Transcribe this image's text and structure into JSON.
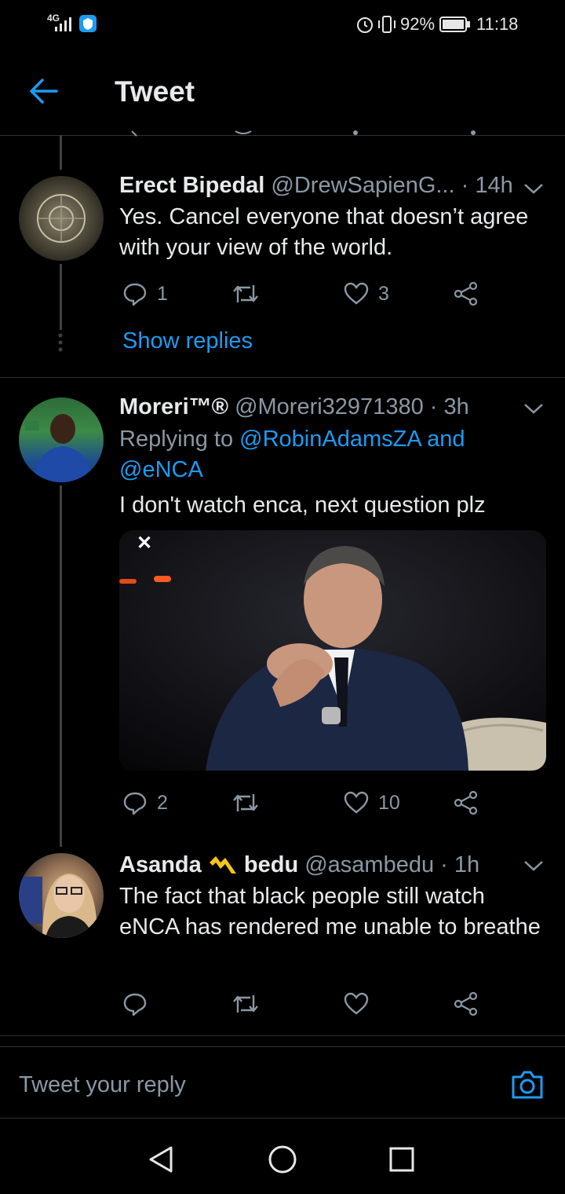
{
  "status_bar": {
    "network": "4G",
    "battery": "92%",
    "time": "11:18"
  },
  "header": {
    "title": "Tweet"
  },
  "tweets": [
    {
      "name": "Erect Bipedal",
      "handle": "@DrewSapienG...",
      "time": "· 14h",
      "text": "Yes. Cancel everyone that doesn’t agree with your view of the world.",
      "replies": "1",
      "retweets": "",
      "likes": "3",
      "show_replies": "Show replies"
    },
    {
      "name": "Moreri™®",
      "handle": "@Moreri32971380",
      "time": "· 3h",
      "replying_prefix": "Replying to",
      "replying_to_1": "@RobinAdamsZA",
      "replying_and": "and",
      "replying_to_2": "@eNCA",
      "text": "I don't watch enca, next question plz",
      "media_close": "✕",
      "replies": "2",
      "retweets": "",
      "likes": "10"
    },
    {
      "name_part1": "Asanda",
      "name_part2": "bedu",
      "handle": "@asambedu",
      "time": "· 1h",
      "text": "The fact that black people still watch eNCA has rendered me unable to breathe",
      "replies": "",
      "retweets": "",
      "likes": ""
    }
  ],
  "reply_bar": {
    "placeholder": "Tweet your reply"
  },
  "colors": {
    "accent": "#1d9bf0",
    "background": "#000000",
    "muted": "#8b98a5"
  }
}
